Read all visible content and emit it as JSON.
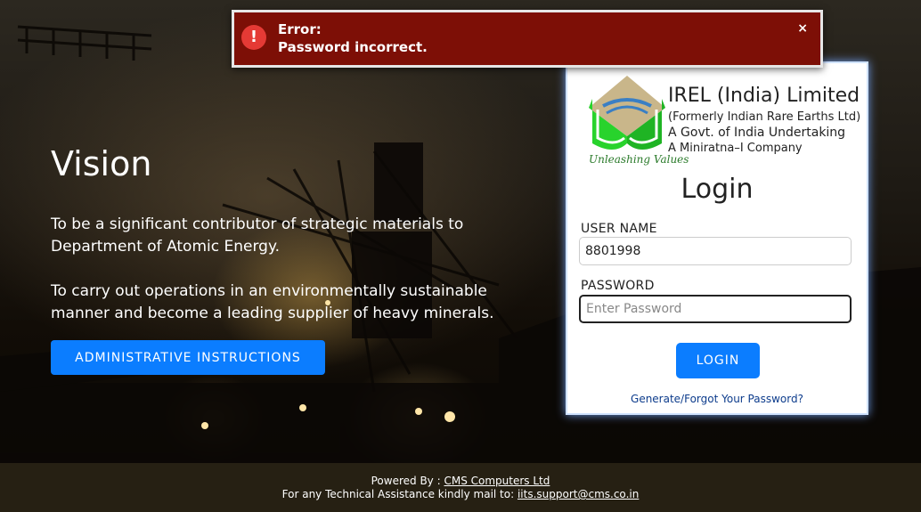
{
  "vision": {
    "title": "Vision",
    "paragraph_1": "To be a significant contributor of strategic materials to Department of Atomic Energy.",
    "paragraph_2": "To carry out operations in an environmentally sustainable manner and become a leading supplier of heavy minerals.",
    "admin_button": "ADMINISTRATIVE INSTRUCTIONS"
  },
  "error": {
    "title": "Error:",
    "message": "Password incorrect.",
    "close": "×",
    "icon": "exclamation-icon",
    "color": "#7d0f06"
  },
  "login": {
    "org_name": "IREL (India) Limited",
    "org_line_1": "(Formerly Indian Rare Earths Ltd)",
    "org_line_2": "A Govt. of India Undertaking",
    "org_line_3": "A Miniratna–I Company",
    "tagline": "Unleashing Values",
    "title": "Login",
    "username_label": "USER NAME",
    "username_value": "8801998",
    "password_label": "PASSWORD",
    "password_placeholder": "Enter Password",
    "login_button": "LOGIN",
    "forgot_link": "Generate/Forgot Your Password?",
    "accent_color": "#0b7dff"
  },
  "footer": {
    "powered_by_label": "Powered By :",
    "powered_by_link": "CMS Computers Ltd",
    "assistance_label": "For any Technical Assistance kindly mail to:",
    "assistance_email": "iits.support@cms.co.in"
  }
}
